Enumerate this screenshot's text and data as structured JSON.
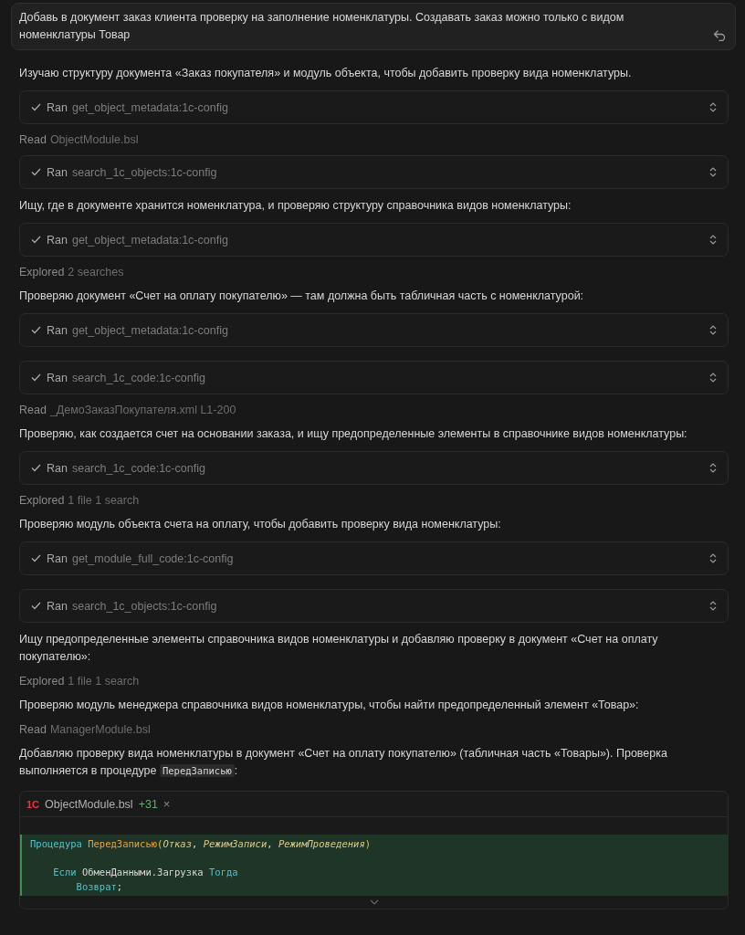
{
  "prompt": {
    "text": "Добавь в документ заказ клиента проверку на заполнение номенклатуры. Создавать заказ можно только с видом номенклатуры Товар"
  },
  "items": [
    {
      "kind": "para",
      "parts": [
        {
          "kind": "text",
          "text": "Изучаю структуру документа «Заказ покупателя» и модуль объекта, чтобы добавить проверку вида номенклатуры."
        }
      ]
    },
    {
      "kind": "tool",
      "verb": "Ran",
      "detail": "get_object_metadata:1c-config"
    },
    {
      "kind": "meta",
      "verb": "Read",
      "detail": "ObjectModule.bsl"
    },
    {
      "kind": "tool",
      "verb": "Ran",
      "detail": "search_1c_objects:1c-config"
    },
    {
      "kind": "para",
      "parts": [
        {
          "kind": "text",
          "text": "Ищу, где в документе хранится номенклатура, и проверяю структуру справочника видов номенклатуры:"
        }
      ]
    },
    {
      "kind": "tool",
      "verb": "Ran",
      "detail": "get_object_metadata:1c-config"
    },
    {
      "kind": "meta",
      "verb": "Explored",
      "detail": "2 searches"
    },
    {
      "kind": "para",
      "parts": [
        {
          "kind": "text",
          "text": "Проверяю документ «Счет на оплату покупателю» — там должна быть табличная часть с номенклатурой:"
        }
      ]
    },
    {
      "kind": "tool",
      "verb": "Ran",
      "detail": "get_object_metadata:1c-config"
    },
    {
      "kind": "tool",
      "verb": "Ran",
      "detail": "search_1c_code:1c-config"
    },
    {
      "kind": "meta",
      "verb": "Read",
      "detail": "_ДемоЗаказПокупателя.xml L1-200"
    },
    {
      "kind": "para",
      "parts": [
        {
          "kind": "text",
          "text": "Проверяю, как создается счет на основании заказа, и ищу предопределенные элементы в справочнике видов номенклатуры:"
        }
      ]
    },
    {
      "kind": "tool",
      "verb": "Ran",
      "detail": "search_1c_code:1c-config"
    },
    {
      "kind": "meta",
      "verb": "Explored",
      "detail": "1 file 1 search"
    },
    {
      "kind": "para",
      "parts": [
        {
          "kind": "text",
          "text": "Проверяю модуль объекта счета на оплату, чтобы добавить проверку вида номенклатуры:"
        }
      ]
    },
    {
      "kind": "tool",
      "verb": "Ran",
      "detail": "get_module_full_code:1c-config"
    },
    {
      "kind": "tool",
      "verb": "Ran",
      "detail": "search_1c_objects:1c-config"
    },
    {
      "kind": "para",
      "parts": [
        {
          "kind": "text",
          "text": "Ищу предопределенные элементы справочника видов номенклатуры и добавляю проверку в документ «Счет на оплату покупателю»:"
        }
      ]
    },
    {
      "kind": "meta",
      "verb": "Explored",
      "detail": "1 file 1 search"
    },
    {
      "kind": "para",
      "parts": [
        {
          "kind": "text",
          "text": "Проверяю модуль менеджера справочника видов номенклатуры, чтобы найти предопределенный элемент «Товар»:"
        }
      ]
    },
    {
      "kind": "meta",
      "verb": "Read",
      "detail": "ManagerModule.bsl"
    },
    {
      "kind": "para",
      "parts": [
        {
          "kind": "text",
          "text": "Добавляю проверку вида номенклатуры в документ «Счет на оплату покупателю» (табличная часть «Товары»). Проверка выполняется в процедуре "
        },
        {
          "kind": "code",
          "text": "ПередЗаписью"
        },
        {
          "kind": "text",
          "text": ":"
        }
      ]
    }
  ],
  "code_block": {
    "logo": "1С",
    "file": "ObjectModule.bsl",
    "added": "+31",
    "close": "×",
    "lines": [
      {
        "kind": "code",
        "tokens": [
          {
            "kind": "keyword",
            "text": "Процедура"
          },
          {
            "kind": "space"
          },
          {
            "kind": "func",
            "text": "ПередЗаписью"
          },
          {
            "kind": "paren",
            "text": "("
          },
          {
            "kind": "param",
            "text": "Отказ"
          },
          {
            "kind": "plain",
            "text": ", "
          },
          {
            "kind": "param",
            "text": "РежимЗаписи"
          },
          {
            "kind": "plain",
            "text": ", "
          },
          {
            "kind": "param",
            "text": "РежимПроведения"
          },
          {
            "kind": "paren",
            "text": ")"
          }
        ]
      },
      {
        "kind": "blank"
      },
      {
        "kind": "code",
        "tokens": [
          {
            "kind": "tab"
          },
          {
            "kind": "keyword",
            "text": "Если"
          },
          {
            "kind": "plain",
            "text": " ОбменДанными.Загрузка "
          },
          {
            "kind": "keyword",
            "text": "Тогда"
          }
        ]
      },
      {
        "kind": "code",
        "tokens": [
          {
            "kind": "tab"
          },
          {
            "kind": "tab"
          },
          {
            "kind": "keyword",
            "text": "Возврат"
          },
          {
            "kind": "plain",
            "text": ";"
          }
        ]
      }
    ]
  }
}
